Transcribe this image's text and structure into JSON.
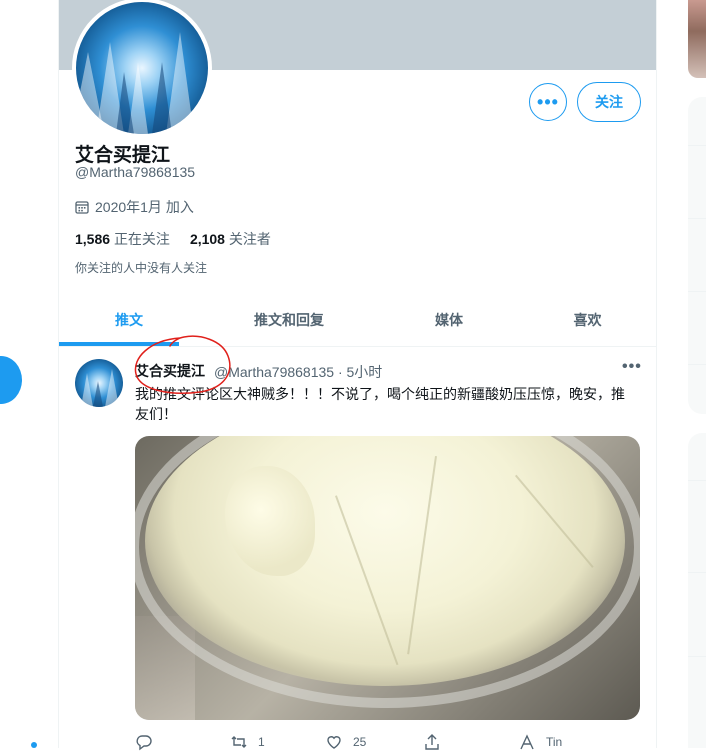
{
  "profile": {
    "name": "艾合买提江",
    "handle": "@Martha79868135",
    "joined": "2020年1月 加入",
    "following_count": "1,586",
    "following_label": "正在关注",
    "followers_count": "2,108",
    "followers_label": "关注者",
    "followed_by_none": "你关注的人中没有人关注"
  },
  "buttons": {
    "more_label": "•••",
    "follow_label": "关注"
  },
  "tabs": [
    {
      "label": "推文",
      "active": true
    },
    {
      "label": "推文和回复",
      "active": false
    },
    {
      "label": "媒体",
      "active": false
    },
    {
      "label": "喜欢",
      "active": false
    }
  ],
  "tweet": {
    "author": "艾合买提江",
    "meta": "@Martha79868135 · 5小时",
    "more": "•••",
    "text": "我的推文评论区大神贼多！！！不说了，喝个纯正的新疆酸奶压压惊，晚安，推友们！",
    "actions": {
      "reply_count": "",
      "retweet_count": "1",
      "like_count": "25",
      "share_label": "",
      "translate_label": "Tin"
    }
  },
  "colors": {
    "accent": "#1d9bf0",
    "text_primary": "#0f1419",
    "text_secondary": "#536471",
    "banner": "#c4cfd6",
    "annotation": "#e0201b"
  },
  "icons": [
    "calendar-icon",
    "reply-icon",
    "retweet-icon",
    "like-icon",
    "share-icon",
    "translate-icon",
    "more-icon"
  ]
}
